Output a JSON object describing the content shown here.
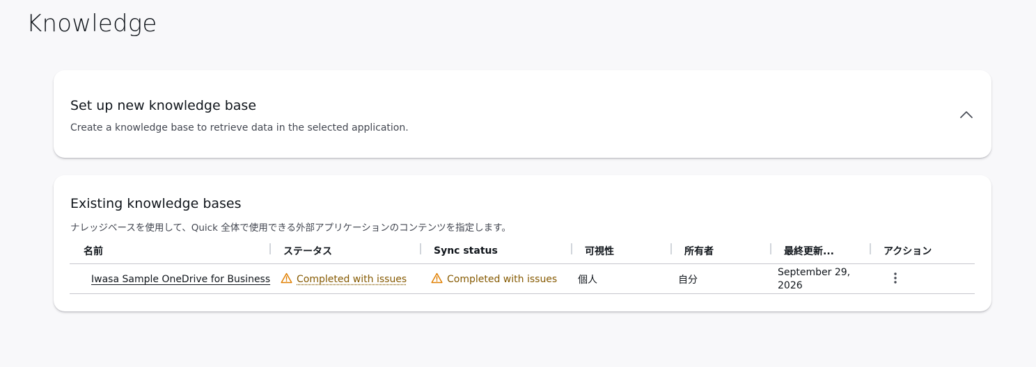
{
  "page": {
    "title": "Knowledge"
  },
  "setup_card": {
    "title": "Set up new knowledge base",
    "description": "Create a knowledge base to retrieve data in the selected application."
  },
  "existing_card": {
    "title": "Existing knowledge bases",
    "description": "ナレッジベースを使用して、Quick 全体で使用できる外部アプリケーションのコンテンツを指定します。",
    "columns": {
      "name": "名前",
      "status": "ステータス",
      "sync_status": "Sync status",
      "visibility": "可視性",
      "owner": "所有者",
      "last_updated": "最終更新...",
      "actions": "アクション"
    },
    "rows": [
      {
        "name": "Iwasa Sample OneDrive for Business",
        "status": "Completed with issues",
        "sync_status": "Completed with issues",
        "visibility": "個人",
        "owner": "自分",
        "last_updated_line1": "September 29,",
        "last_updated_line2": "2026"
      }
    ]
  },
  "colors": {
    "warning": "#855900",
    "warning_icon": "#e07f00"
  },
  "icons": {
    "collapse": "chevron-up-icon",
    "status": "warning-icon",
    "actions": "more-vertical-icon"
  }
}
